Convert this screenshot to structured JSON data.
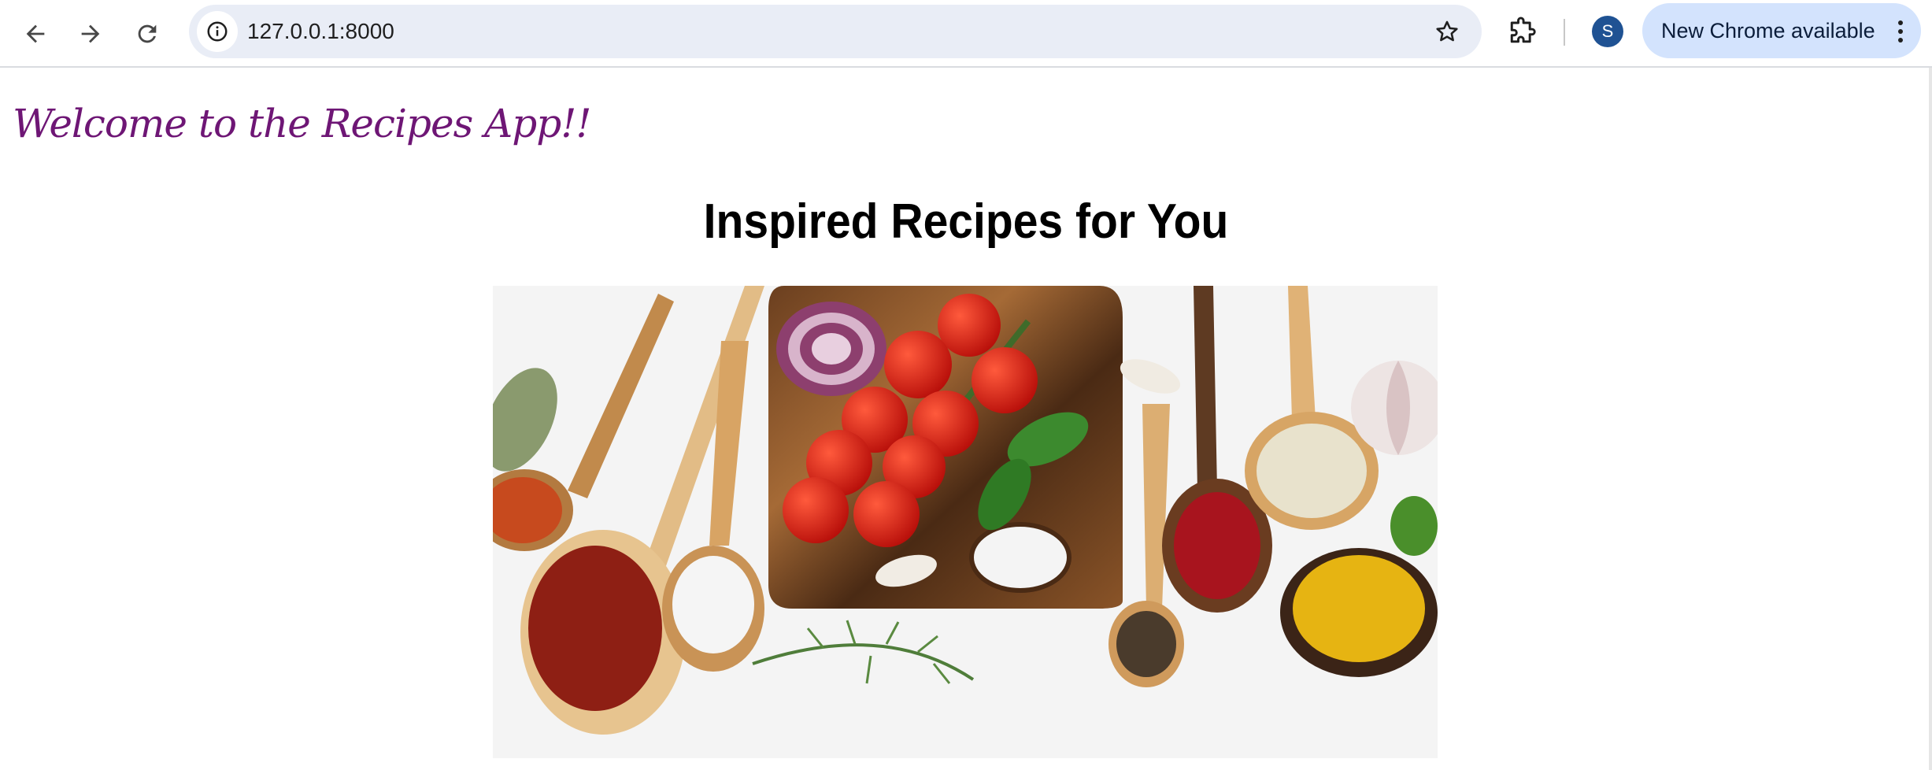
{
  "browser": {
    "url": "127.0.0.1:8000",
    "profile_initial": "S",
    "update_button_label": "New Chrome available",
    "icons": [
      "back-icon",
      "forward-icon",
      "reload-icon",
      "site-info-icon",
      "bookmark-star-icon",
      "extensions-icon",
      "kebab-menu-icon"
    ]
  },
  "page": {
    "welcome_text": "Welcome to the Recipes App!!",
    "heading": "Inspired Recipes for You",
    "hero_image": "spices-tomatoes-wooden-spoons"
  },
  "colors": {
    "welcome_text": "#6e1675",
    "omnibox_bg": "#e9edf6",
    "update_pill_bg": "#d3e3fd",
    "avatar_bg": "#1f5293"
  }
}
